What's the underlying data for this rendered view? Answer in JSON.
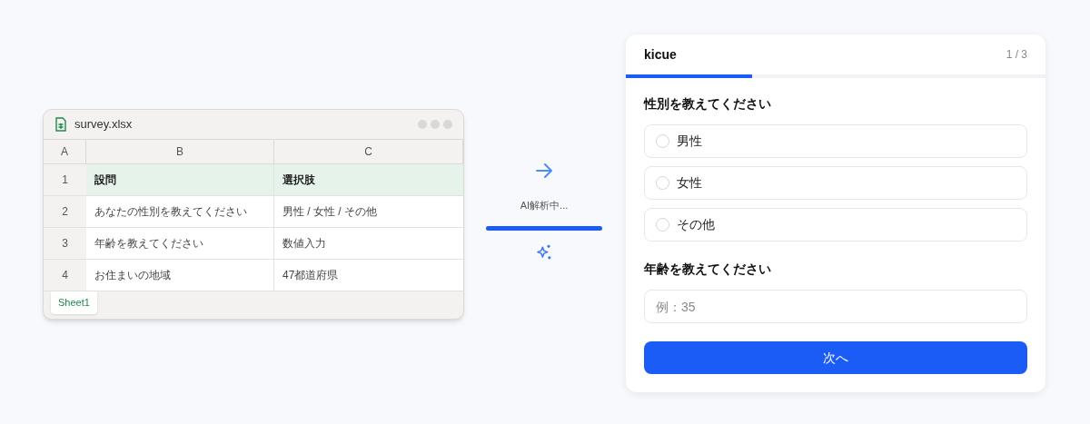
{
  "spreadsheet": {
    "file_name": "survey.xlsx",
    "columns": [
      "A",
      "B",
      "C"
    ],
    "rows": [
      {
        "number": "1",
        "header": true,
        "cells": [
          "設問",
          "選択肢"
        ]
      },
      {
        "number": "2",
        "header": false,
        "cells": [
          "あなたの性別を教えてください",
          "男性 / 女性 / その他"
        ]
      },
      {
        "number": "3",
        "header": false,
        "cells": [
          "年齢を教えてください",
          "数値入力"
        ]
      },
      {
        "number": "4",
        "header": false,
        "cells": [
          "お住まいの地域",
          "47都道府県"
        ]
      }
    ],
    "sheet_tabs": [
      {
        "label": "Sheet1",
        "selected": true
      }
    ]
  },
  "conversion": {
    "status": "AI解析中...",
    "level": 1
  },
  "form": {
    "brand": "kicue",
    "page": "1 / 3",
    "level": 0.3,
    "questions": [
      {
        "kind": "radio",
        "title": "性別を教えてください",
        "options": [
          {
            "label": "男性",
            "selected": false
          },
          {
            "label": "女性",
            "selected": false
          },
          {
            "label": "その他",
            "selected": false
          }
        ]
      },
      {
        "kind": "number",
        "title": "年齢を教えてください",
        "placeholder": "例：35"
      }
    ],
    "submit": "次へ"
  }
}
